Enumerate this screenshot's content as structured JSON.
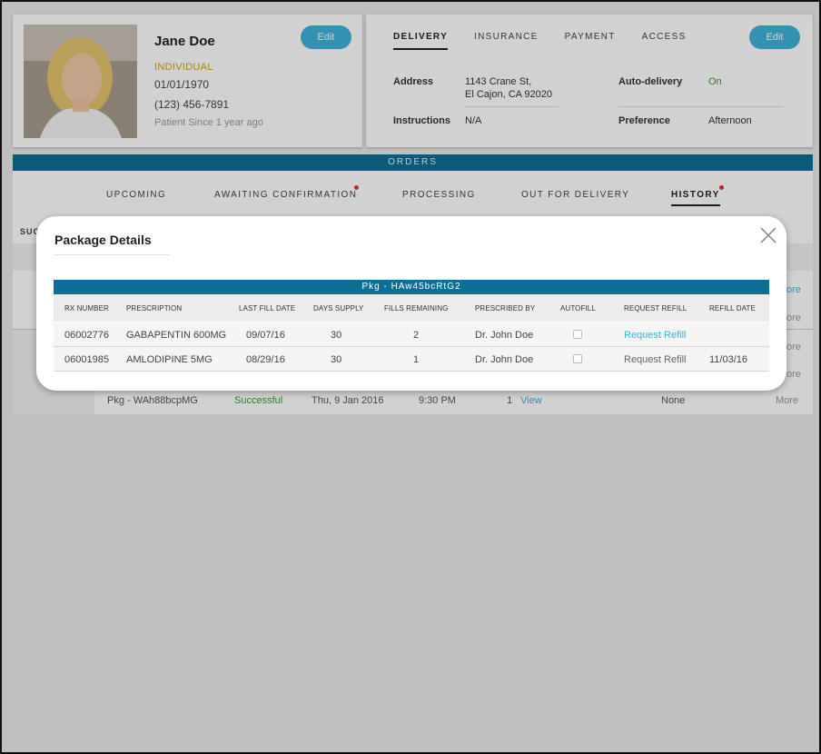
{
  "patient": {
    "name": "Jane Doe",
    "type": "INDIVIDUAL",
    "dob": "01/01/1970",
    "phone": "(123) 456-7891",
    "since": "Patient Since 1 year ago",
    "edit_label": "Edit"
  },
  "delivery": {
    "tabs": [
      "DELIVERY",
      "INSURANCE",
      "PAYMENT",
      "ACCESS"
    ],
    "edit_label": "Edit",
    "address_label": "Address",
    "address_line1": "1143 Crane St,",
    "address_line2": "El Cajon, CA 92020",
    "instructions_label": "Instructions",
    "instructions_value": "N/A",
    "autodelivery_label": "Auto-delivery",
    "autodelivery_value": "On",
    "preference_label": "Preference",
    "preference_value": "Afternoon"
  },
  "orders": {
    "title": "ORDERS",
    "tabs": [
      "UPCOMING",
      "AWAITING CONFIRMATION",
      "PROCESSING",
      "OUT FOR DELIVERY",
      "HISTORY"
    ],
    "partial_label": "SUC",
    "more_label": "More",
    "more_partial": "ore",
    "row": {
      "package": "Pkg - WAh88bcpMG",
      "status": "Successful",
      "date": "Thu, 9 Jan 2016",
      "time": "9:30 PM",
      "count": "1",
      "view": "View",
      "refill": "None",
      "more": "More"
    }
  },
  "modal": {
    "title": "Package Details",
    "package_id": "Pkg - HAw45bcRtG2",
    "columns": [
      "RX NUMBER",
      "PRESCRIPTION",
      "LAST FILL DATE",
      "DAYS SUPPLY",
      "FILLS REMAINING",
      "PRESCRIBED BY",
      "AUTOFILL",
      "REQUEST REFILL",
      "REFILL DATE"
    ],
    "rows": [
      {
        "rx": "06002776",
        "prescription": "GABAPENTIN 600MG",
        "last_fill": "09/07/16",
        "days": "30",
        "fills": "2",
        "prescriber": "Dr. John Doe",
        "request": "Request Refill",
        "refill_date": ""
      },
      {
        "rx": "06001985",
        "prescription": "AMLODIPINE 5MG",
        "last_fill": "08/29/16",
        "days": "30",
        "fills": "1",
        "prescriber": "Dr. John Doe",
        "request": "Request Refill",
        "refill_date": "11/03/16"
      }
    ]
  },
  "colors": {
    "accent": "#3fb2d8",
    "header_bar": "#0d6f96",
    "success": "#2e9e2e",
    "type_label": "#d4a017"
  }
}
